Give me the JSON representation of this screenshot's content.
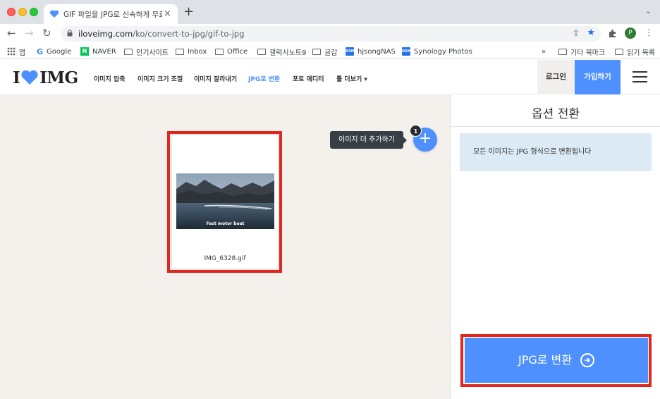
{
  "browser": {
    "tab_title": "GIF 파일을 JPG로 신속하게 무료 변환",
    "tab_close": "×",
    "new_tab": "+",
    "tab_menu": "⌄",
    "back": "←",
    "forward": "→",
    "reload": "↻",
    "url_domain": "iloveimg.com",
    "url_path": "/ko/convert-to-jpg/gif-to-jpg",
    "profile_initial": "P",
    "bookmarks": [
      {
        "label": "앱",
        "icon": "apps-grid-icon"
      },
      {
        "label": "Google",
        "icon": "google-icon"
      },
      {
        "label": "NAVER",
        "icon": "naver-icon"
      },
      {
        "label": "인기사이트",
        "icon": "folder-icon"
      },
      {
        "label": "Inbox",
        "icon": "folder-icon"
      },
      {
        "label": "Office",
        "icon": "folder-icon"
      },
      {
        "label": "갤럭시노트9",
        "icon": "folder-icon"
      },
      {
        "label": "글감",
        "icon": "folder-icon"
      },
      {
        "label": "hjsongNAS",
        "icon": "dsm-icon"
      },
      {
        "label": "Synology Photos",
        "icon": "dsm-icon"
      }
    ],
    "bookmarks_more": "»",
    "bookmarks_other": "기타 북마크",
    "reading_list": "읽기 목록"
  },
  "header": {
    "logo_left": "I",
    "logo_right": "IMG",
    "nav": [
      {
        "label": "이미지 압축",
        "active": false
      },
      {
        "label": "이미지 크기 조절",
        "active": false
      },
      {
        "label": "이미지 잘라내기",
        "active": false
      },
      {
        "label": "JPG로 변환",
        "active": true
      },
      {
        "label": "포토 에디터",
        "active": false
      },
      {
        "label": "툴 더보기 ▾",
        "active": false
      }
    ],
    "login": "로그인",
    "signup": "가입하기"
  },
  "workarea": {
    "file_name": "IMG_6328.gif",
    "thumbnail_caption": "Fast motor boat",
    "tooltip": "이미지 더 추가하기",
    "add_button": "+",
    "file_count": "1"
  },
  "sidebar": {
    "title": "옵션 전환",
    "info": "모든 이미지는 JPG 형식으로 변환됩니다",
    "convert_label": "JPG로 변환"
  },
  "colors": {
    "accent": "#4d90fe",
    "highlight": "#e0271d",
    "info_bg": "#dbeaf5",
    "work_bg": "#f4f1ec"
  }
}
